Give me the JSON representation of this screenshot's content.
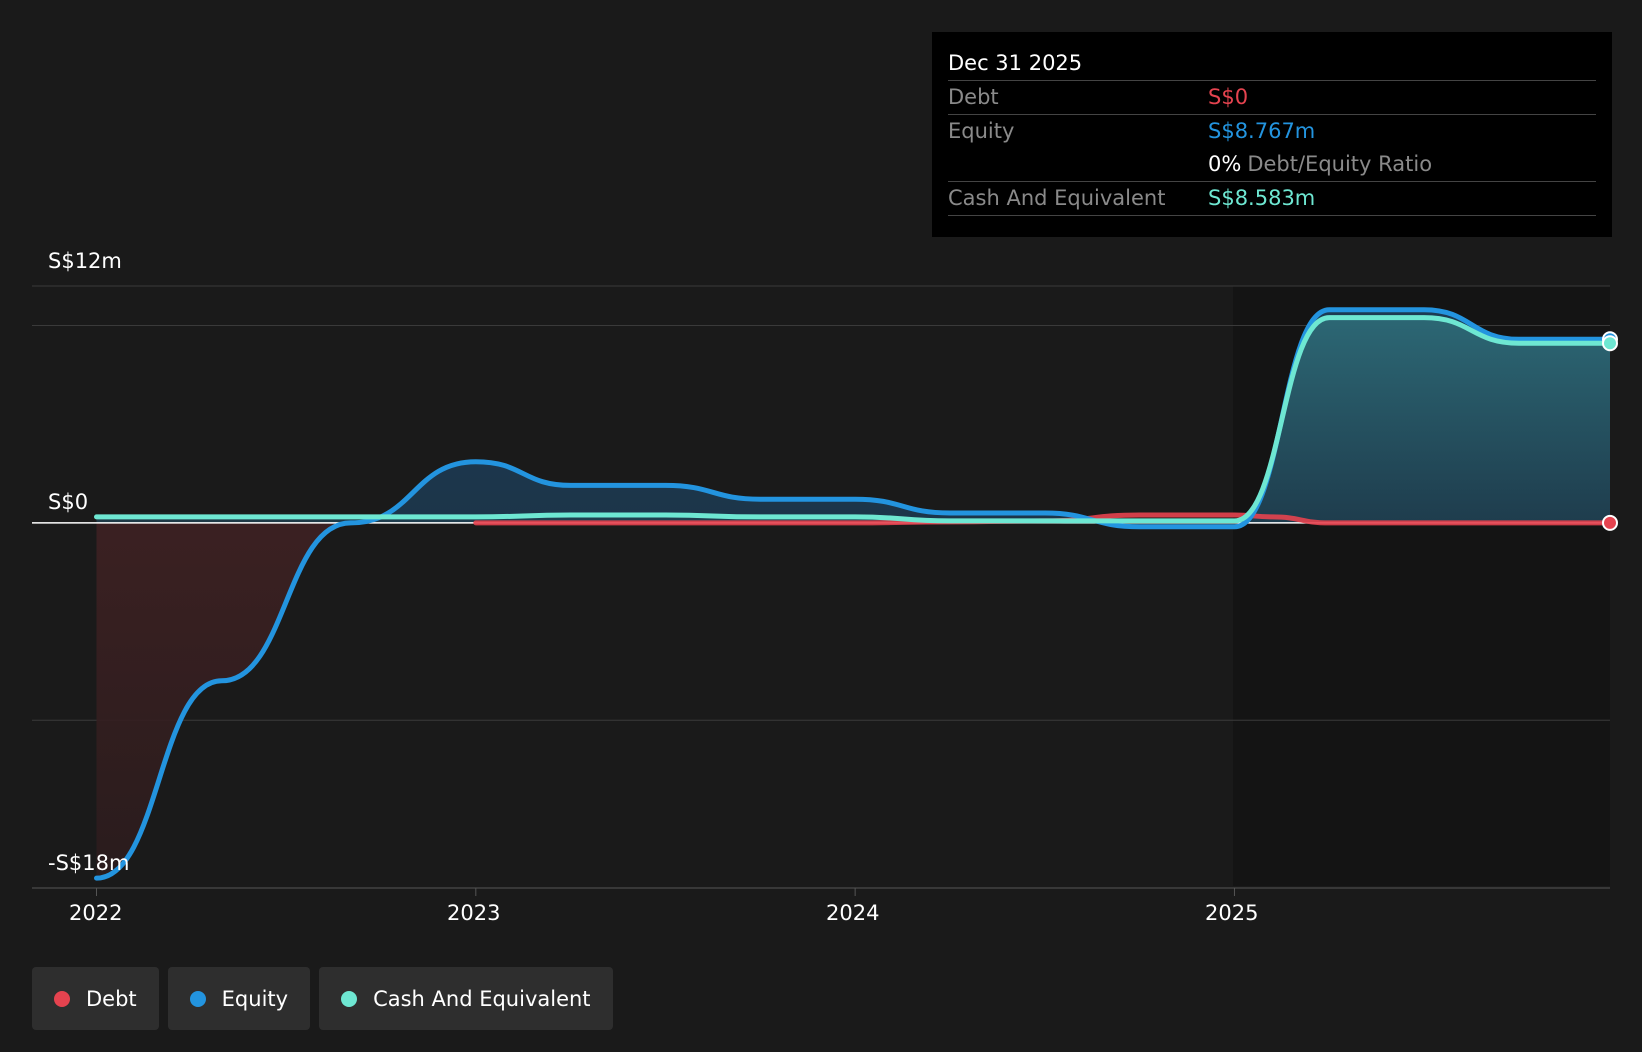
{
  "tooltip": {
    "date": "Dec 31 2025",
    "debt_label": "Debt",
    "debt_value": "S$0",
    "equity_label": "Equity",
    "equity_value": "S$8.767m",
    "ratio_value": "0%",
    "ratio_label": "Debt/Equity Ratio",
    "cash_label": "Cash And Equivalent",
    "cash_value": "S$8.583m"
  },
  "legend": [
    {
      "label": "Debt",
      "color": "#e5434f"
    },
    {
      "label": "Equity",
      "color": "#2394df"
    },
    {
      "label": "Cash And Equivalent",
      "color": "#6ee7d2"
    }
  ],
  "chart_data": {
    "type": "area",
    "y_tick_labels": [
      "S$12m",
      "S$0",
      "-S$18m"
    ],
    "x_tick_labels": [
      "2022",
      "2023",
      "2024",
      "2025"
    ],
    "ylim": [
      -18.5,
      12
    ],
    "xlim": [
      2021.83,
      2025.99
    ],
    "grid": true,
    "colors": {
      "debt": "#e5434f",
      "equity": "#2394df",
      "cash": "#6ee7d2"
    },
    "series": [
      {
        "name": "Debt",
        "x": [
          2023.0,
          2023.5,
          2024.0,
          2024.25,
          2024.5,
          2024.75,
          2025.0,
          2025.1,
          2025.25,
          2025.5,
          2025.75,
          2025.99
        ],
        "values": [
          0.0,
          0.0,
          0.0,
          0.05,
          0.1,
          0.4,
          0.4,
          0.3,
          0.0,
          0.0,
          0.0,
          0.0
        ]
      },
      {
        "name": "Equity",
        "x": [
          2022.0,
          2022.33,
          2022.67,
          2023.0,
          2023.25,
          2023.5,
          2023.75,
          2024.0,
          2024.25,
          2024.5,
          2024.75,
          2025.0,
          2025.25,
          2025.5,
          2025.75,
          2025.99
        ],
        "values": [
          -18.0,
          -8.0,
          0.0,
          3.1,
          1.9,
          1.9,
          1.2,
          1.2,
          0.5,
          0.5,
          -0.2,
          -0.2,
          10.8,
          10.8,
          9.3,
          9.3
        ]
      },
      {
        "name": "Cash And Equivalent",
        "x": [
          2022.0,
          2022.5,
          2023.0,
          2023.25,
          2023.5,
          2023.75,
          2024.0,
          2024.25,
          2024.5,
          2024.75,
          2025.0,
          2025.25,
          2025.5,
          2025.75,
          2025.99
        ],
        "values": [
          0.3,
          0.3,
          0.3,
          0.4,
          0.4,
          0.3,
          0.3,
          0.1,
          0.1,
          0.1,
          0.1,
          10.4,
          10.4,
          9.1,
          9.1
        ]
      }
    ]
  }
}
